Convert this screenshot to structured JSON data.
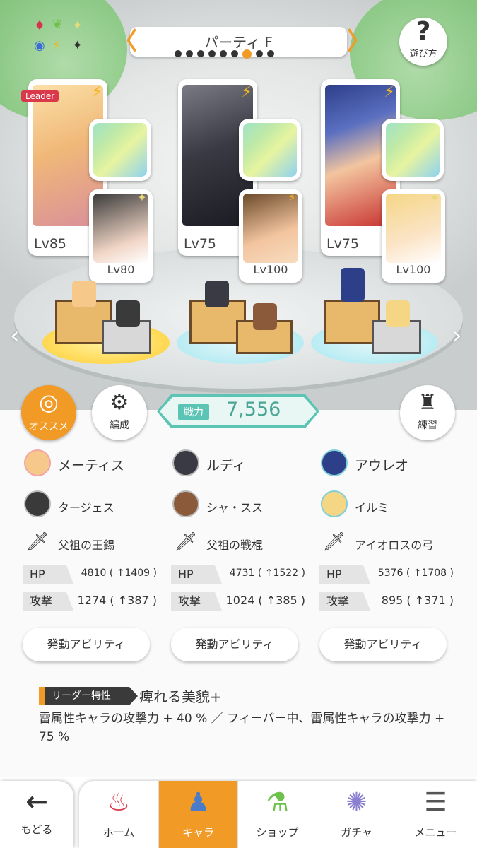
{
  "header": {
    "party_title": "パーティ F",
    "page_dots": 9,
    "active_dot": 6,
    "help_label": "遊び方"
  },
  "units": [
    {
      "leader_tag": "Leader",
      "main_level": "Lv85",
      "sub_level": "Lv80",
      "main_name": "メーティス",
      "sub_name": "タージェス",
      "weapon_name": "父祖の王錫",
      "hp_label": "HP",
      "hp_value": "4810 ( ↑1409 )",
      "atk_label": "攻撃",
      "atk_value": "1274 ( ↑387 )",
      "ability_label": "発動アビリティ",
      "portrait_colors": [
        "#f6c98a",
        "#e9c2d6"
      ],
      "sub_colors": [
        "#3a3a3a",
        "#f1d6c6"
      ]
    },
    {
      "leader_tag": "",
      "main_level": "Lv75",
      "sub_level": "Lv100",
      "main_name": "ルディ",
      "sub_name": "シャ・スス",
      "weapon_name": "父祖の戦棍",
      "hp_label": "HP",
      "hp_value": "4731 ( ↑1522 )",
      "atk_label": "攻撃",
      "atk_value": "1024 ( ↑385 )",
      "ability_label": "発動アビリティ",
      "portrait_colors": [
        "#4d4d57",
        "#23232b"
      ],
      "sub_colors": [
        "#6b4a2a",
        "#f3c59f"
      ]
    },
    {
      "leader_tag": "",
      "main_level": "Lv75",
      "sub_level": "Lv100",
      "main_name": "アウレオ",
      "sub_name": "イルミ",
      "weapon_name": "アイオロスの弓",
      "hp_label": "HP",
      "hp_value": "5376 ( ↑1708 )",
      "atk_label": "攻撃",
      "atk_value": "895 ( ↑371 )",
      "ability_label": "発動アビリティ",
      "portrait_colors": [
        "#2e3f8a",
        "#c7302f"
      ],
      "sub_colors": [
        "#f5d684",
        "#fbe4c6"
      ]
    }
  ],
  "actions": {
    "recommend_label": "オススメ",
    "formation_label": "編成",
    "power_label": "戦力",
    "power_value": "7,556",
    "practice_label": "練習"
  },
  "leader_skill": {
    "tag": "リーダー特性",
    "name": "痺れる美貌+",
    "description": "雷属性キャラの攻撃力 + 40 % ／ フィーバー中、雷属性キャラの攻撃力 + 75 %"
  },
  "nav": {
    "back_label": "もどる",
    "tabs": [
      {
        "label": "ホーム",
        "icon": "home-icon"
      },
      {
        "label": "キャラ",
        "icon": "character-icon"
      },
      {
        "label": "ショップ",
        "icon": "shop-icon"
      },
      {
        "label": "ガチャ",
        "icon": "gacha-icon"
      },
      {
        "label": "メニュー",
        "icon": "menu-icon"
      }
    ],
    "active_tab": 1
  },
  "colors": {
    "accent": "#f29a26",
    "teal": "#5bc4b4",
    "thunder": "#f2b51c"
  }
}
